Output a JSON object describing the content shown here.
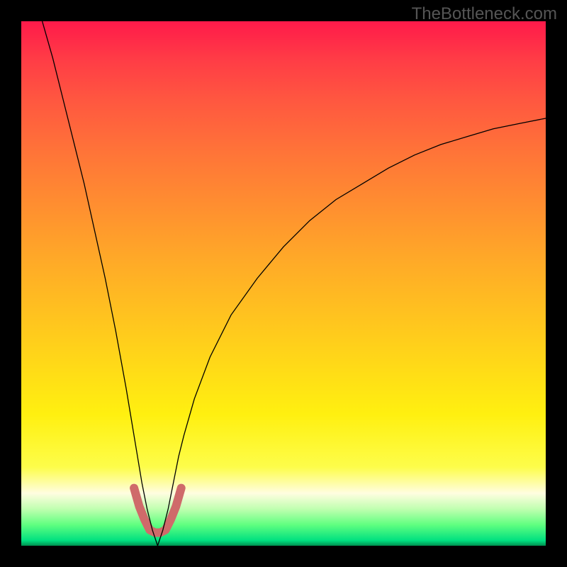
{
  "watermark_text": "TheBottleneck.com",
  "chart_data": {
    "type": "line",
    "title": "",
    "xlabel": "",
    "ylabel": "",
    "xlim": [
      0,
      100
    ],
    "ylim": [
      0,
      100
    ],
    "x_optimum": 26,
    "background_gradient": {
      "orientation": "vertical",
      "stops": [
        {
          "pos": 0.0,
          "color": "#ff1a4a"
        },
        {
          "pos": 0.07,
          "color": "#ff3b46"
        },
        {
          "pos": 0.15,
          "color": "#ff5740"
        },
        {
          "pos": 0.25,
          "color": "#ff7438"
        },
        {
          "pos": 0.35,
          "color": "#ff8e30"
        },
        {
          "pos": 0.45,
          "color": "#ffa828"
        },
        {
          "pos": 0.55,
          "color": "#ffc020"
        },
        {
          "pos": 0.65,
          "color": "#ffd818"
        },
        {
          "pos": 0.75,
          "color": "#fff010"
        },
        {
          "pos": 0.85,
          "color": "#fdfd4a"
        },
        {
          "pos": 0.9,
          "color": "#fffde0"
        },
        {
          "pos": 0.93,
          "color": "#c0ffb0"
        },
        {
          "pos": 0.96,
          "color": "#60ff80"
        },
        {
          "pos": 0.99,
          "color": "#00e080"
        },
        {
          "pos": 1.0,
          "color": "#009050"
        }
      ]
    },
    "series": [
      {
        "name": "bottleneck-curve",
        "stroke": "#000000",
        "stroke_width": 1.3,
        "x": [
          4,
          6,
          8,
          10,
          12,
          14,
          16,
          18,
          20,
          21,
          22,
          23,
          24,
          25,
          26,
          27,
          28,
          29,
          30,
          31,
          33,
          36,
          40,
          45,
          50,
          55,
          60,
          65,
          70,
          75,
          80,
          85,
          90,
          95,
          100
        ],
        "y": [
          100,
          93,
          85,
          77,
          69,
          60,
          51,
          41,
          30,
          24,
          18,
          12,
          7,
          3,
          0,
          3,
          7,
          12,
          17,
          21,
          28,
          36,
          44,
          51,
          57,
          62,
          66,
          69,
          72,
          74.5,
          76.5,
          78,
          79.5,
          80.5,
          81.5
        ]
      },
      {
        "name": "highlight-segment",
        "stroke": "#cf6a6a",
        "stroke_width": 12,
        "linecap": "round",
        "x": [
          21.5,
          22.5,
          23.5,
          24.5,
          25.5,
          26.5,
          27.5,
          28.5,
          29.5,
          30.5
        ],
        "y": [
          11,
          7.5,
          5,
          3,
          2.5,
          2.5,
          3,
          5,
          7.5,
          11
        ]
      }
    ]
  }
}
